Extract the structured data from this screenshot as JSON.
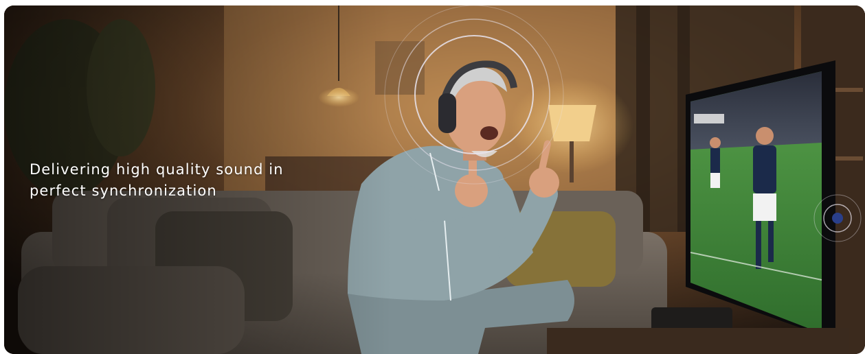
{
  "banner": {
    "headline_line1": "Delivering high quality sound in",
    "headline_line2": "perfect synchronization"
  },
  "scene": {
    "description_icons": [
      "headphones-icon",
      "sound-wave-icon",
      "tv-icon"
    ],
    "colors": {
      "room_dark": "#2a1d14",
      "lamp_glow": "#f5c46b",
      "pitch_green": "#3f8a3a",
      "sofa": "#6b6156",
      "pajamas": "#8fa3a8"
    }
  }
}
